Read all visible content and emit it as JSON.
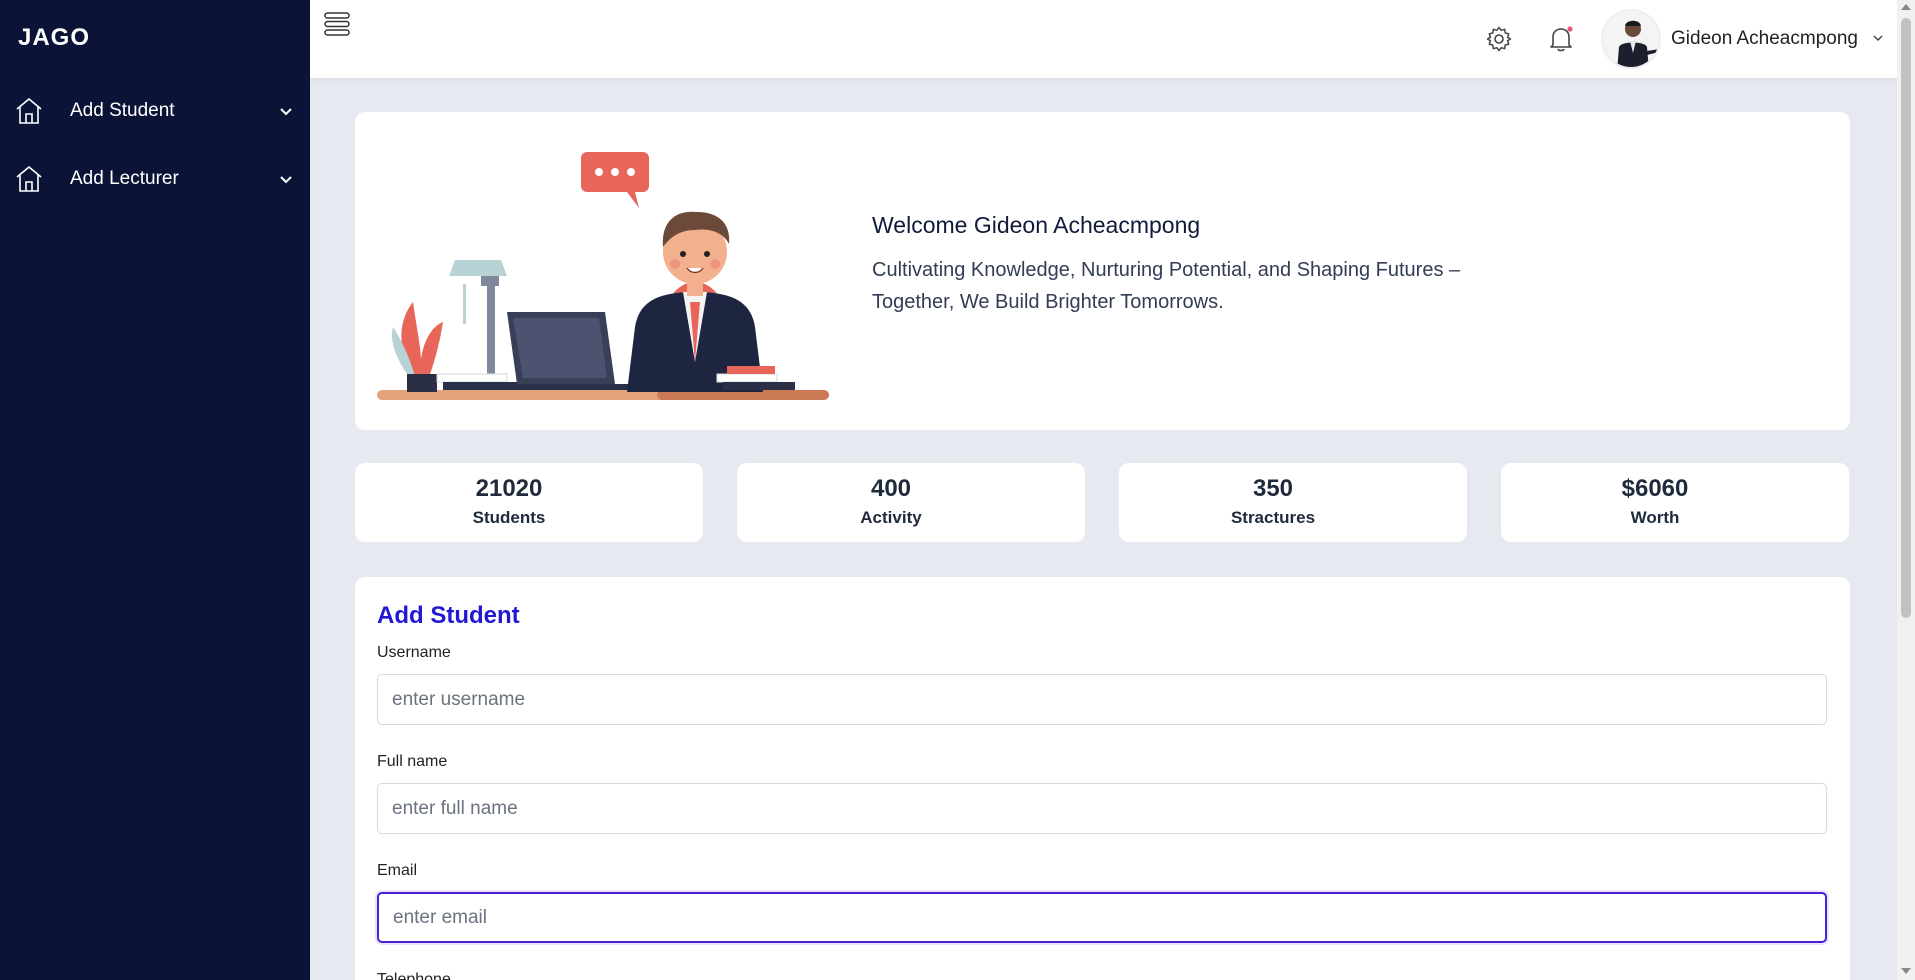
{
  "sidebar": {
    "brand": "JAGO",
    "items": [
      {
        "label": "Add Student",
        "icon": "home-icon"
      },
      {
        "label": "Add Lecturer",
        "icon": "home-icon"
      }
    ]
  },
  "topbar": {
    "user_name": "Gideon Acheacmpong",
    "notification_dot_color": "#e8577a"
  },
  "welcome": {
    "title": "Welcome Gideon Acheacmpong",
    "text": "Cultivating Knowledge, Nurturing Potential, and Shaping Futures – Together, We Build Brighter Tomorrows."
  },
  "stats": [
    {
      "value": "21020",
      "label": "Students"
    },
    {
      "value": "400",
      "label": "Activity"
    },
    {
      "value": "350",
      "label": "Stractures"
    },
    {
      "value": "$6060",
      "label": "Worth"
    }
  ],
  "form": {
    "title": "Add Student",
    "fields": [
      {
        "label": "Username",
        "placeholder": "enter username",
        "value": ""
      },
      {
        "label": "Full name",
        "placeholder": "enter full name",
        "value": ""
      },
      {
        "label": "Email",
        "placeholder": "enter email",
        "value": ""
      },
      {
        "label": "Telephone"
      }
    ]
  },
  "colors": {
    "sidebar_bg": "#0b1437",
    "accent": "#2317d6",
    "page_bg": "#e6e9ef"
  }
}
